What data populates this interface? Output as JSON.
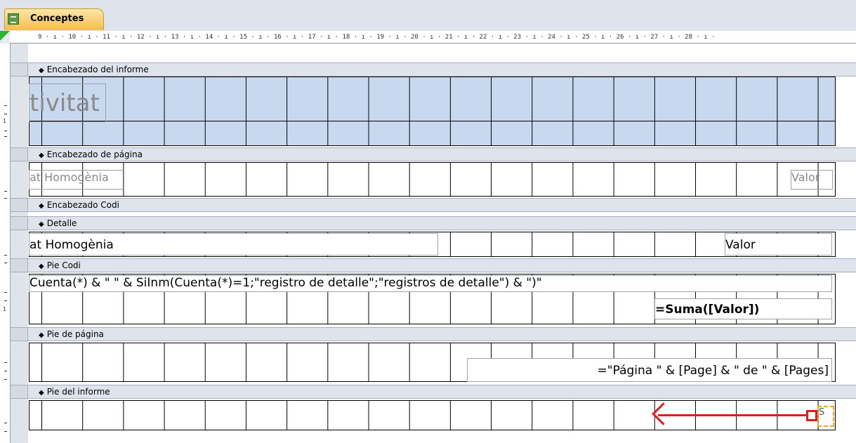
{
  "tab": {
    "label": "Conceptes"
  },
  "ruler": {
    "text": "9 · ı · 10 · ı · 11 · ı · 12 · ı · 13 · ı · 14 · ı · 15 · ı · 16 · ı · 17 · ı · 18 · ı · 19 · ı · 20 · ı · 21 · ı · 22 · ı · 23 · ı · 24 · ı · 25 · ı · 26 · ı · 27 · ı · 28 · ı ·"
  },
  "sections": {
    "report_header": "Encabezado del informe",
    "page_header": "Encabezado de página",
    "group_header": "Encabezado Codi",
    "detail": "Detalle",
    "group_footer": "Pie Codi",
    "page_footer": "Pie de página",
    "report_footer": "Pie del informe"
  },
  "controls": {
    "title": "tivitat",
    "page_header_label": "at Homogènia",
    "page_header_value": "Valor",
    "detail_field": "at Homogènia",
    "detail_value": "Valor",
    "group_footer_count": "Cuenta(*) & \" \" & SiInm(Cuenta(*)=1;\"registro de detalle\";\"registros de detalle\") & \")\"",
    "group_footer_sum": "=Suma([Valor])",
    "page_footer_expr": "=\"Página \" & [Page] & \" de \" & [Pages]",
    "report_footer_small": "S"
  },
  "colors": {
    "accent_tab": "#f6bd4f",
    "report_header_bg": "#c8d8ee",
    "arrow": "#e11c1c",
    "selection": "#f5a623"
  }
}
